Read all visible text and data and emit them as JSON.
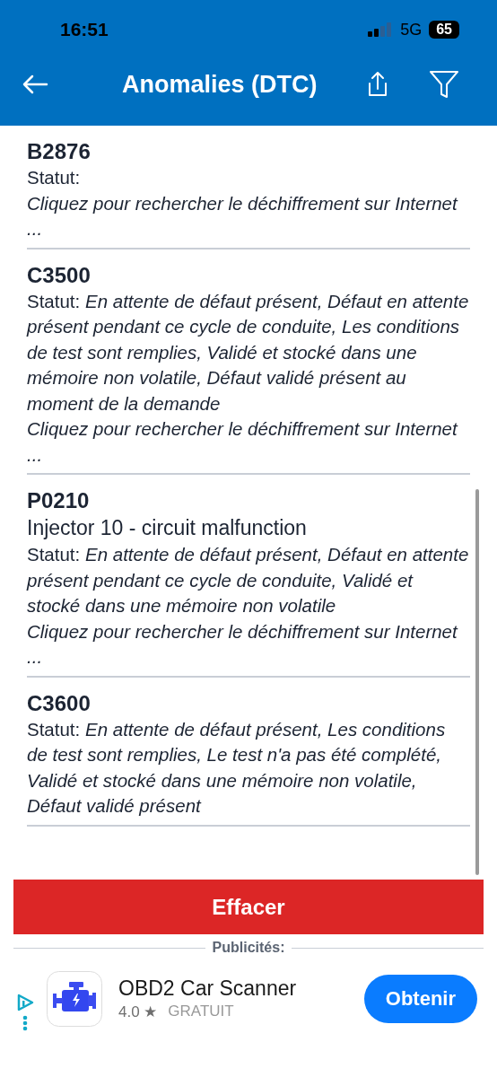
{
  "status_bar": {
    "time": "16:51",
    "network": "5G",
    "battery": "65"
  },
  "header": {
    "title": "Anomalies (DTC)"
  },
  "dtc_list": [
    {
      "code": "B2876",
      "status": "Statut:",
      "link": "Cliquez pour rechercher le déchiffrement sur Internet ..."
    },
    {
      "code": "C3500",
      "status": "Statut: *En attente de défaut présent, Défaut en attente présent pendant ce cycle de conduite, Les conditions de test sont remplies, Validé et stocké dans une mémoire non volatile, Défaut validé présent au moment de la demande*",
      "link": "Cliquez pour rechercher le déchiffrement sur Internet ..."
    },
    {
      "code": "P0210",
      "description": "Injector 10 - circuit malfunction",
      "status": "Statut: *En attente de défaut présent, Défaut en attente présent pendant ce cycle de conduite, Validé et stocké dans une mémoire non volatile*",
      "link": "Cliquez pour rechercher le déchiffrement sur Internet ..."
    },
    {
      "code": "C3600",
      "status": "Statut: *En attente de défaut présent, Les conditions de test sont remplies, Le test n'a pas été complété, Validé et stocké dans une mémoire non volatile, Défaut validé présent*"
    }
  ],
  "clear_button": "Effacer",
  "ads": {
    "label": "Publicités:",
    "app_name": "OBD2 Car Scanner",
    "rating": "4.0 ★",
    "price": "GRATUIT",
    "button": "Obtenir"
  }
}
